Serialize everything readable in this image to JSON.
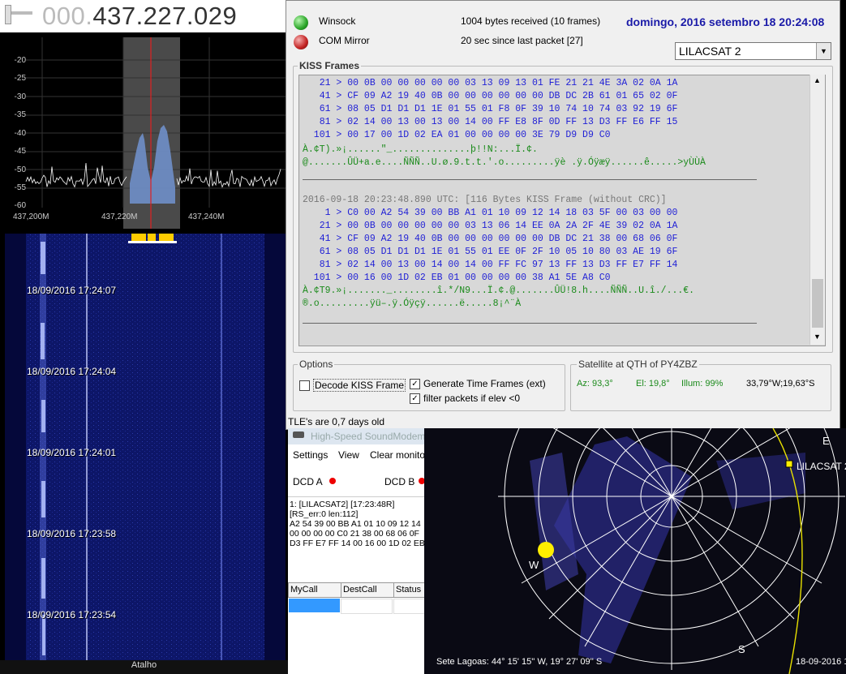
{
  "sdr": {
    "frequency_dim": "000.",
    "frequency_main": "437.227.029",
    "y_ticks": [
      "-20",
      "-25",
      "-30",
      "-35",
      "-40",
      "-45",
      "-50",
      "-55",
      "-60"
    ],
    "x_ticks": [
      "437,200M",
      "437,220M",
      "437,240M"
    ],
    "timestamps": [
      "18/09/2016 17:24:07",
      "18/09/2016 17:24:04",
      "18/09/2016 17:24:01",
      "18/09/2016 17:23:58",
      "18/09/2016 17:23:54"
    ],
    "shortcut": "Atalho"
  },
  "status": {
    "winsock_label": "Winsock",
    "com_label": "COM Mirror",
    "bytes_received": "1004 bytes received (10 frames)",
    "since_last": "20 sec since last packet [27]",
    "date": "domingo, 2016 setembro 18  20:24:08",
    "satellite_select": "LILACSAT 2"
  },
  "kiss": {
    "title": "KISS Frames",
    "block1": [
      "   21 > 00 0B 00 00 00 00 00 03 13 09 13 01 FE 21 21 4E 3A 02 0A 1A",
      "   41 > CF 09 A2 19 40 0B 00 00 00 00 00 00 DB DC 2B 61 01 65 02 0F",
      "   61 > 08 05 D1 D1 D1 1E 01 55 01 F8 0F 39 10 74 10 74 03 92 19 6F",
      "   81 > 02 14 00 13 00 13 00 14 00 FF E8 8F 0D FF 13 D3 FF E6 FF 15",
      "  101 > 00 17 00 1D 02 EA 01 00 00 00 00 3E 79 D9 D9 C0"
    ],
    "ascii1a": "À.¢T).»¡......\"_..............þ!!N:...Ï.¢.",
    "ascii1b": "@.......ÛÜ+a.e....ÑÑÑ..U.ø.9.t.t.'.o.........ÿè .ÿ.Óÿæÿ......ê.....>yÙÙÀ",
    "header2": "2016-09-18 20:23:48.890 UTC: [116 Bytes KISS Frame (without CRC)]",
    "block2": [
      "    1 > C0 00 A2 54 39 00 BB A1 01 10 09 12 14 18 03 5F 00 03 00 00",
      "   21 > 00 0B 00 00 00 00 00 03 13 06 14 EE 0A 2A 2F 4E 39 02 0A 1A",
      "   41 > CF 09 A2 19 40 0B 00 00 00 00 00 00 DB DC 21 38 00 68 06 0F",
      "   61 > 08 05 D1 D1 D1 1E 01 55 01 EE 0F 2F 10 05 10 80 03 AE 19 6F",
      "   81 > 02 14 00 13 00 14 00 14 00 FF FC 97 13 FF 13 D3 FF E7 FF 14",
      "  101 > 00 16 00 1D 02 EB 01 00 00 00 00 38 A1 5E A8 C0"
    ],
    "ascii2a": "À.¢T9.»¡......._........î.*/N9...Ï.¢.@.......ÛÜ!8.h....ÑÑÑ..U.î./...€.",
    "ascii2b": "®.o.........ÿü–.ÿ.Óÿçÿ......ë.....8¡^¨À"
  },
  "options": {
    "title": "Options",
    "decode_kiss": "Decode KISS Frame",
    "gen_time": "Generate Time Frames (ext)",
    "filter": "filter packets if elev <0"
  },
  "sat_qth": {
    "title": "Satellite at QTH of PY4ZBZ",
    "az": "Az: 93,3°",
    "el": "El: 19,8°",
    "illum": "Illum: 99%",
    "pos": "33,79°W;19,63°S"
  },
  "tle": "TLE's are 0,7 days old",
  "modem": {
    "title": "High-Speed SoundModem",
    "menu": [
      "Settings",
      "View",
      "Clear monito"
    ],
    "dcd_a": "DCD A",
    "dcd_b": "DCD B",
    "lines": [
      "1: [LILACSAT2] [17:23:48R]",
      "[RS_err:0 len:112]",
      "A2 54 39 00 BB A1 01 10 09 12 14",
      "00 00 00 00 C0 21 38 00 68 06 0F",
      "D3 FF E7 FF 14 00 16 00 1D 02 EB"
    ],
    "col_mycall": "MyCall",
    "col_destcall": "DestCall",
    "col_status": "Status"
  },
  "polar": {
    "dir_e": "E",
    "dir_w": "W",
    "dir_s": "S",
    "sat_label": "LILACSAT 2",
    "location": "Sete Lagoas: 44° 15' 15'' W, 19° 27' 09'' S",
    "date": "18-09-2016 1"
  },
  "colors": {
    "date_blue": "#1a1aa8",
    "hex_blue": "#1f1fd6",
    "ascii_green": "#1a8a1a",
    "sun": "#ffee00",
    "orbit": "#e8e000"
  }
}
